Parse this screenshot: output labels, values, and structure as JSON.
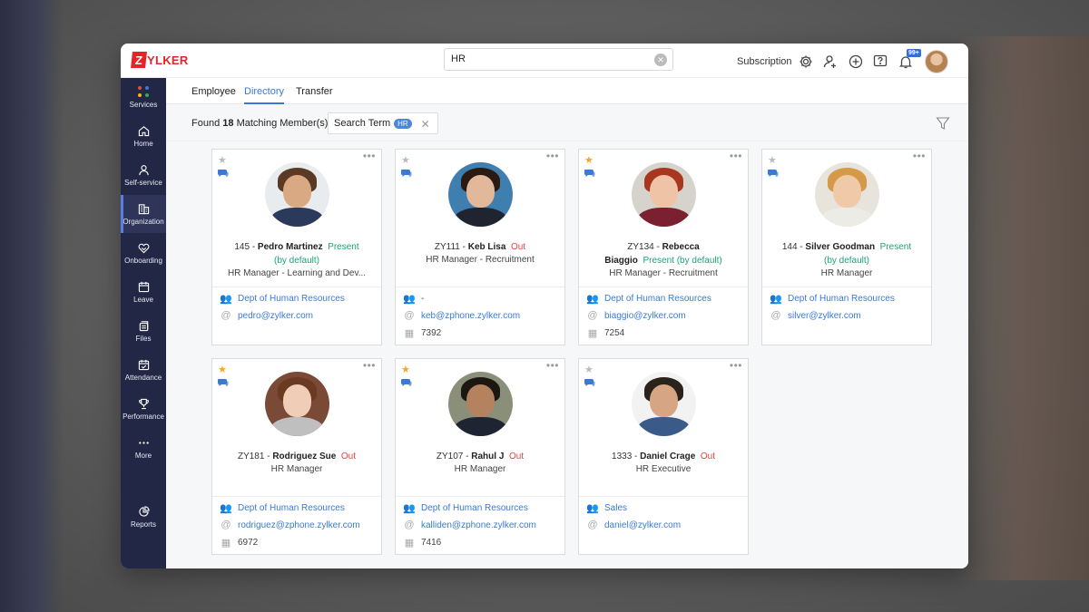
{
  "brand": {
    "logo_letter": "Z",
    "logo_rest": "YLKER"
  },
  "search": {
    "value": "HR"
  },
  "topbar": {
    "subscription": "Subscription",
    "notif_count": "99+"
  },
  "sidebar": [
    {
      "label": "Services"
    },
    {
      "label": "Home"
    },
    {
      "label": "Self-service"
    },
    {
      "label": "Organization"
    },
    {
      "label": "Onboarding"
    },
    {
      "label": "Leave"
    },
    {
      "label": "Files"
    },
    {
      "label": "Attendance"
    },
    {
      "label": "Performance"
    },
    {
      "label": "More"
    },
    {
      "label": "Reports"
    }
  ],
  "tabs": [
    {
      "label": "Employee"
    },
    {
      "label": "Directory"
    },
    {
      "label": "Transfer"
    }
  ],
  "results": {
    "prefix": "Found",
    "count": "18",
    "suffix": "Matching Member(s)"
  },
  "chip": {
    "label": "Search Term",
    "tag": "HR"
  },
  "colors": {
    "accent": "#3b7ad4",
    "sidebar": "#222745",
    "present": "#1aa37a",
    "out": "#e2453c",
    "star": "#f5a623"
  },
  "cards": [
    {
      "id": "145",
      "name": "Pedro Martinez",
      "status": "Present",
      "status2": "(by default)",
      "role": "HR Manager - Learning and Dev...",
      "dept": "Dept of Human Resources",
      "email": "pedro@zylker.com",
      "starred": false
    },
    {
      "id": "ZY111",
      "name": "Keb Lisa",
      "status": "Out",
      "role": "HR Manager - Recruitment",
      "dept": "-",
      "email": "keb@zphone.zylker.com",
      "phone": "7392",
      "starred": false
    },
    {
      "id": "ZY134",
      "name": "Rebecca",
      "name2": "Biaggio",
      "status": "Present (by default)",
      "role": "HR Manager - Recruitment",
      "dept": "Dept of Human Resources",
      "email": "biaggio@zylker.com",
      "phone": "7254",
      "starred": true
    },
    {
      "id": "144",
      "name": "Silver Goodman",
      "status": "Present",
      "status2": "(by default)",
      "role": "HR Manager",
      "dept": "Dept of Human Resources",
      "email": "silver@zylker.com",
      "starred": false
    },
    {
      "id": "ZY181",
      "name": "Rodriguez Sue",
      "status": "Out",
      "role": "HR Manager",
      "dept": "Dept of Human Resources",
      "email": "rodriguez@zphone.zylker.com",
      "phone": "6972",
      "starred": true
    },
    {
      "id": "ZY107",
      "name": "Rahul J",
      "status": "Out",
      "role": "HR Manager",
      "dept": "Dept of Human Resources",
      "email": "kalliden@zphone.zylker.com",
      "phone": "7416",
      "starred": true
    },
    {
      "id": "1333",
      "name": "Daniel Crage",
      "status": "Out",
      "role": "HR Executive",
      "dept": "Sales",
      "email": "daniel@zylker.com",
      "starred": false
    }
  ]
}
